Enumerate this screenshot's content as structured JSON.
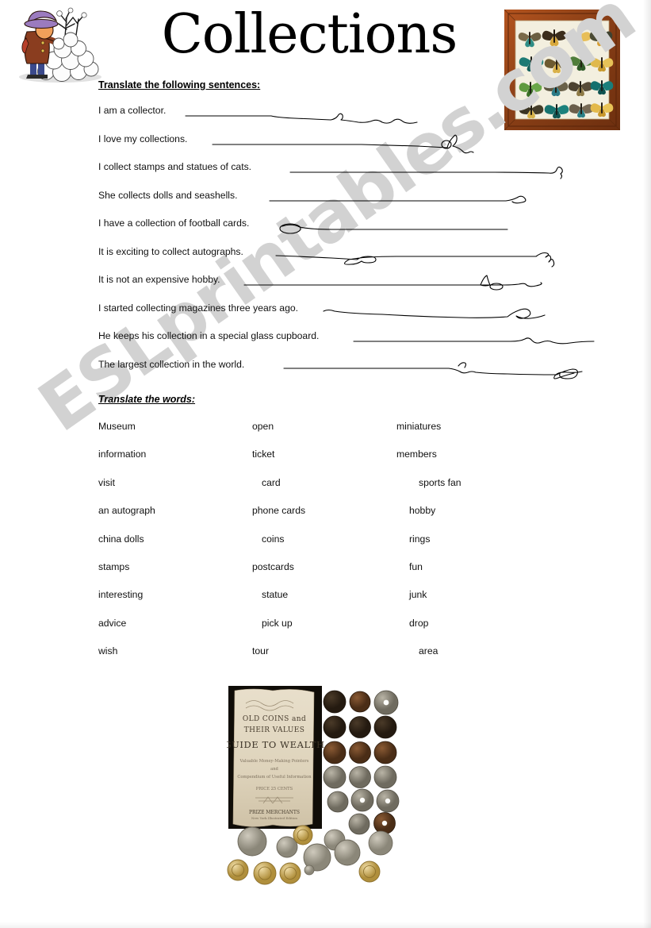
{
  "document": {
    "title": "Collections",
    "watermark": "ESLprintables.com"
  },
  "sections": {
    "sentences_heading": "Translate the following sentences:",
    "words_heading": "Translate the words:"
  },
  "sentences": [
    {
      "text": "I am a collector."
    },
    {
      "text": "I love my collections."
    },
    {
      "text": "I collect stamps and statues of cats."
    },
    {
      "text": "She collects dolls and seashells."
    },
    {
      "text": "I have a collection of football cards."
    },
    {
      "text": "It is exciting to collect autographs."
    },
    {
      "text": "It is not an expensive hobby."
    },
    {
      "text": "I started collecting magazines three years ago."
    },
    {
      "text": "He keeps his collection in a special glass cupboard."
    },
    {
      "text": "The  largest  collection in the world."
    }
  ],
  "words": [
    {
      "col1": "Museum",
      "col2": "open",
      "col3": "miniatures"
    },
    {
      "col1": "information",
      "col2": "ticket",
      "col3": "members"
    },
    {
      "col1": "visit",
      "col2": "card",
      "col3": "sports fan"
    },
    {
      "col1": "an autograph",
      "col2": "phone cards",
      "col3": "hobby"
    },
    {
      "col1": "china dolls",
      "col2": "coins",
      "col3": "rings"
    },
    {
      "col1": "stamps",
      "col2": "postcards",
      "col3": "fun"
    },
    {
      "col1": "interesting",
      "col2": "statue",
      "col3": "junk"
    },
    {
      "col1": "advice",
      "col2": "pick up",
      "col3": "drop"
    },
    {
      "col1": "wish",
      "col2": "tour",
      "col3": "area"
    }
  ],
  "images": {
    "clipart_snowballs": "cartoon-person-in-purple-hat-stacking-snowballs-with-bare-tree",
    "butterfly_frame": "framed-butterfly-collection-four-by-four-grid",
    "coins_photo": "old-coin-collection-with-guide-booklet",
    "coin_booklet_lines": [
      "OLD COINS and",
      "THEIR VALUES",
      "GUIDE TO WEALTH"
    ]
  },
  "colors": {
    "watermark": "#d2d2d2",
    "frame_wood": "#9c4a1c",
    "frame_mat": "#f3efdf",
    "ink": "#000000",
    "hat_purple": "#9b7bbf",
    "coat_brown": "#7d3b20"
  }
}
